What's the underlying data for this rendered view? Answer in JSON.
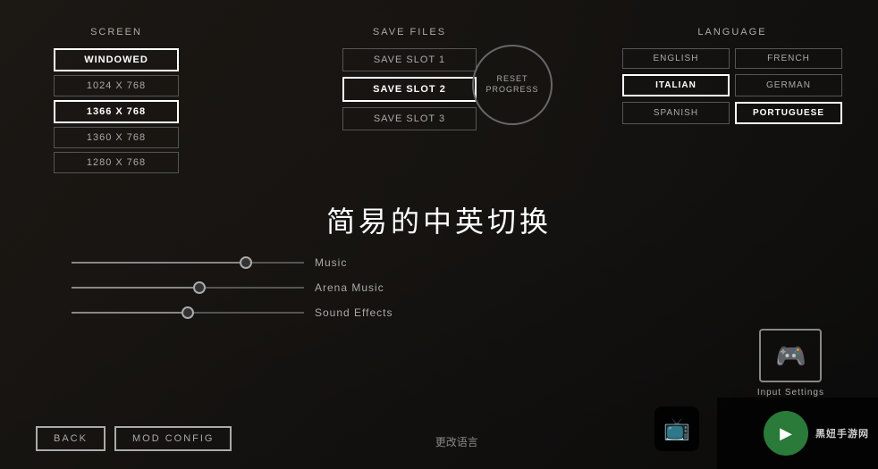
{
  "background": {
    "color": "#151515"
  },
  "screen_section": {
    "title": "SCREEN",
    "options": [
      {
        "label": "WINDOWED",
        "active": true
      },
      {
        "label": "1024 x 768",
        "active": false
      },
      {
        "label": "1366 x 768",
        "active": true
      },
      {
        "label": "1360 x 768",
        "active": false
      },
      {
        "label": "1280 x 768",
        "active": false
      }
    ]
  },
  "save_section": {
    "title": "SAVE FILES",
    "slots": [
      {
        "label": "SAVE SLOT 1",
        "active": false
      },
      {
        "label": "SAVE SLOT 2",
        "active": true
      },
      {
        "label": "SAVE SLOT 3",
        "active": false
      }
    ],
    "reset_label": "RESET PROGRESS"
  },
  "language_section": {
    "title": "LANGUAGE",
    "options": [
      {
        "label": "ENGLISH",
        "active": false
      },
      {
        "label": "FRENCH",
        "active": false
      },
      {
        "label": "ITALIAN",
        "active": true
      },
      {
        "label": "GERMAN",
        "active": false
      },
      {
        "label": "SPANISH",
        "active": false
      },
      {
        "label": "PORTUGUESE",
        "active": true
      }
    ]
  },
  "middle": {
    "chinese_title": "简易的中英切换"
  },
  "sliders": [
    {
      "label": "Music",
      "value": 75,
      "fill_pct": 75
    },
    {
      "label": "Arena Music",
      "value": 55,
      "fill_pct": 55
    },
    {
      "label": "Sound Effects",
      "value": 50,
      "fill_pct": 50
    }
  ],
  "input_settings": {
    "label": "Input Settings",
    "icon": "🎮"
  },
  "bottom": {
    "back_label": "BACK",
    "mod_config_label": "MOD CONFIG",
    "bottom_chinese": "更改语言"
  }
}
